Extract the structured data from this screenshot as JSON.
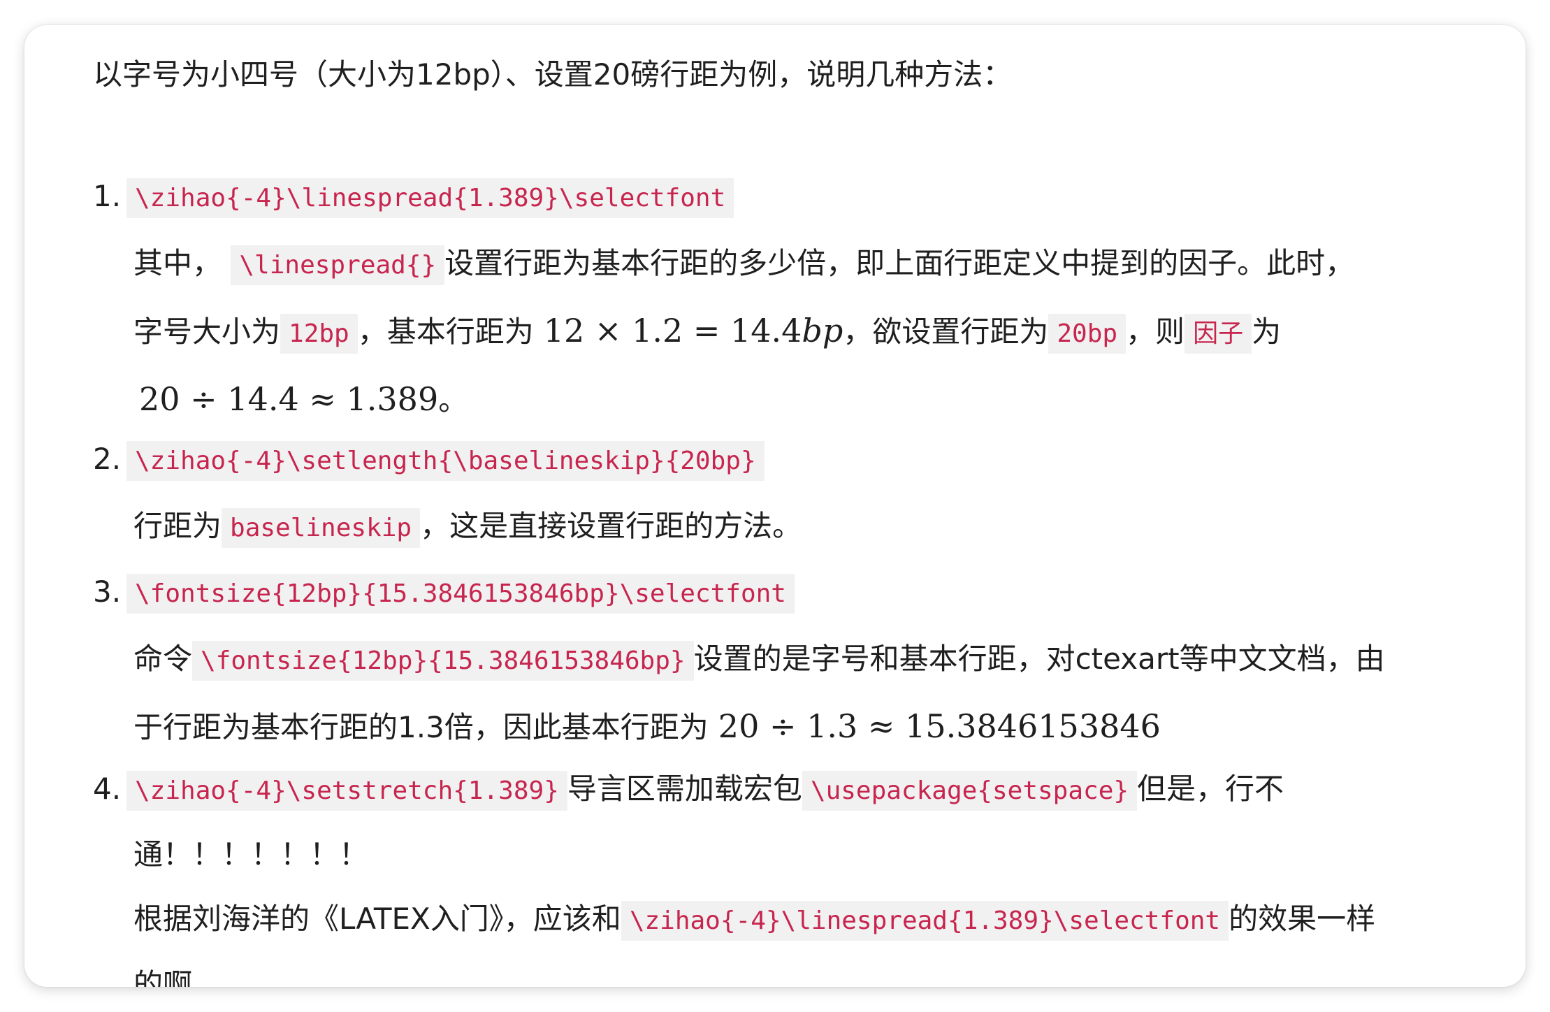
{
  "intro": "以字号为小四号（大小为12bp）、设置20磅行距为例，说明几种方法：",
  "items": [
    {
      "number": "1.",
      "code": "\\zihao{-4}\\linespread{1.389}\\selectfont",
      "line1": {
        "pre": "其中，",
        "code": "\\linespread{}",
        "post": "设置行距为基本行距的多少倍，即上面行距定义中提到的因子。此时，"
      },
      "line2": {
        "pre": "字号大小为",
        "code1": "12bp",
        "mid1": "，基本行距为",
        "math": "12 × 1.2 = 14.4",
        "math_italic": "bp",
        "mid2": "，欲设置行距为",
        "code2": "20bp",
        "mid3": "，则",
        "code3": "因子",
        "post": "为"
      },
      "line3": {
        "math": "20 ÷ 14.4 ≈ 1.389",
        "post": "。"
      }
    },
    {
      "number": "2.",
      "code": "\\zihao{-4}\\setlength{\\baselineskip}{20bp}",
      "line1": {
        "pre": "行距为",
        "code": "baselineskip",
        "post": "，这是直接设置行距的方法。"
      }
    },
    {
      "number": "3.",
      "code": "\\fontsize{12bp}{15.3846153846bp}\\selectfont",
      "line1": {
        "pre": "命令",
        "code": "\\fontsize{12bp}{15.3846153846bp}",
        "post": "设置的是字号和基本行距，对ctexart等中文文档，由"
      },
      "line2": {
        "pre": "于行距为基本行距的1.3倍，因此基本行距为",
        "math": "20 ÷ 1.3 ≈ 15.3846153846"
      }
    },
    {
      "number": "4.",
      "code": "\\zihao{-4}\\setstretch{1.389}",
      "mid": "导言区需加载宏包",
      "code2": "\\usepackage{setspace}",
      "post": "但是，行不",
      "line1": "通！！！！！！！",
      "line2": {
        "pre": "根据刘海洋的《LATEX入门》，应该和",
        "code": "\\zihao{-4}\\linespread{1.389}\\selectfont",
        "post": "的效果一样"
      },
      "line3": "的啊。"
    }
  ]
}
